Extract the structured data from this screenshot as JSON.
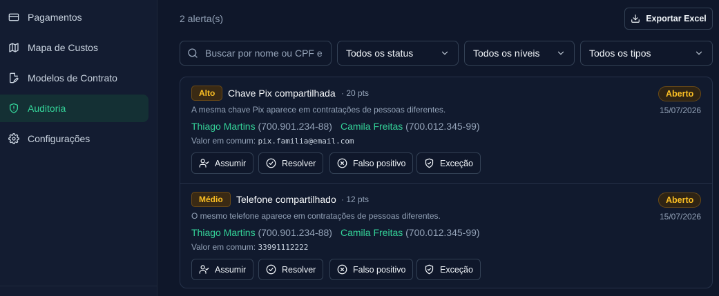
{
  "sidebar": {
    "items": [
      {
        "label": "Pagamentos",
        "icon": "credit-card-icon"
      },
      {
        "label": "Mapa de Custos",
        "icon": "map-icon"
      },
      {
        "label": "Modelos de Contrato",
        "icon": "file-edit-icon"
      },
      {
        "label": "Auditoria",
        "icon": "shield-alert-icon",
        "active": true
      },
      {
        "label": "Configurações",
        "icon": "gear-icon"
      }
    ]
  },
  "header": {
    "alert_count": "2 alerta(s)",
    "export_label": "Exportar Excel"
  },
  "filters": {
    "search_placeholder": "Buscar por nome ou CPF e",
    "status": "Todos os status",
    "level": "Todos os níveis",
    "type": "Todos os tipos"
  },
  "alerts": [
    {
      "level": "Alto",
      "title": "Chave Pix compartilhada",
      "points": "· 20 pts",
      "description": "A mesma chave Pix aparece em contratações de pessoas diferentes.",
      "person1_name": "Thiago Martins",
      "person1_cpf": "(700.901.234-88)",
      "person2_name": "Camila Freitas",
      "person2_cpf": "(700.012.345-99)",
      "common_label": "Valor em comum:",
      "common_value": "pix.familia@email.com",
      "status": "Aberto",
      "date": "15/07/2026"
    },
    {
      "level": "Médio",
      "title": "Telefone compartilhado",
      "points": "· 12 pts",
      "description": "O mesmo telefone aparece em contratações de pessoas diferentes.",
      "person1_name": "Thiago Martins",
      "person1_cpf": "(700.901.234-88)",
      "person2_name": "Camila Freitas",
      "person2_cpf": "(700.012.345-99)",
      "common_label": "Valor em comum:",
      "common_value": "33991112222",
      "status": "Aberto",
      "date": "15/07/2026"
    }
  ],
  "actions": {
    "assume": "Assumir",
    "resolve": "Resolver",
    "false_positive": "Falso positivo",
    "exception": "Exceção"
  },
  "colors": {
    "accent": "#34d399",
    "warning": "#fbbf24",
    "background": "#0f172a"
  }
}
